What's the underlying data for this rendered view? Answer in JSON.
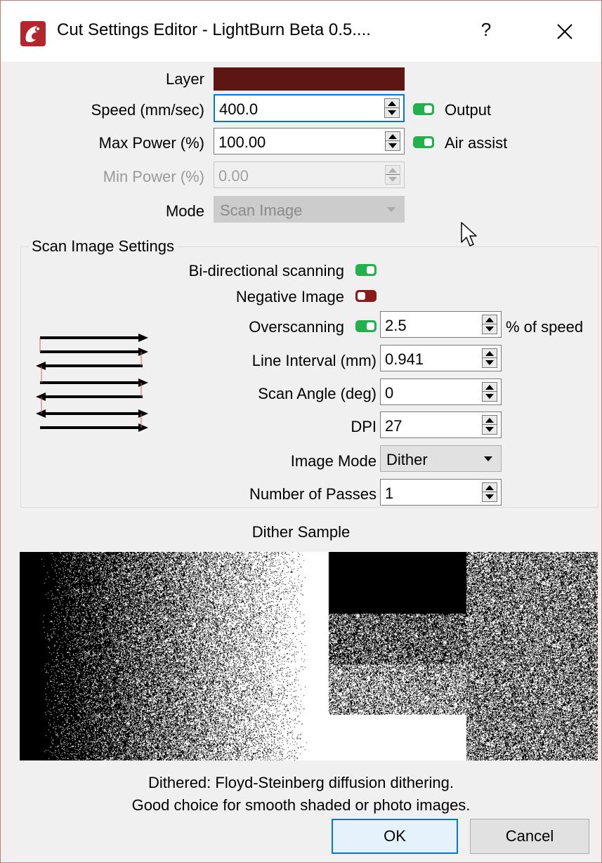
{
  "window": {
    "title": "Cut Settings Editor - LightBurn Beta 0.5....",
    "help": "?"
  },
  "colors": {
    "layer": "#5e1615",
    "toggle_on": "#22b14c",
    "toggle_off": "#8b1a1a",
    "focus": "#0078d7"
  },
  "main": {
    "layer_label": "Layer",
    "speed": {
      "label": "Speed (mm/sec)",
      "value": "400.0"
    },
    "max_power": {
      "label": "Max Power (%)",
      "value": "100.00"
    },
    "min_power": {
      "label": "Min Power (%)",
      "value": "0.00"
    },
    "mode": {
      "label": "Mode",
      "value": "Scan Image"
    },
    "output": {
      "label": "Output",
      "on": true
    },
    "air_assist": {
      "label": "Air assist",
      "on": true
    }
  },
  "scan": {
    "group_title": "Scan Image Settings",
    "bidirectional": {
      "label": "Bi-directional scanning",
      "on": true
    },
    "negative": {
      "label": "Negative Image",
      "on": false
    },
    "overscanning": {
      "label": "Overscanning",
      "on": true,
      "value": "2.5",
      "suffix": "% of speed"
    },
    "line_interval": {
      "label": "Line Interval (mm)",
      "value": "0.941"
    },
    "scan_angle": {
      "label": "Scan Angle (deg)",
      "value": "0"
    },
    "dpi": {
      "label": "DPI",
      "value": "27"
    },
    "image_mode": {
      "label": "Image Mode",
      "value": "Dither"
    },
    "passes": {
      "label": "Number of Passes",
      "value": "1"
    }
  },
  "sample": {
    "title": "Dither Sample",
    "desc1": "Dithered: Floyd-Steinberg diffusion dithering.",
    "desc2": "Good choice for smooth shaded or photo images."
  },
  "buttons": {
    "ok": "OK",
    "cancel": "Cancel"
  },
  "icons": [
    "app-logo-icon",
    "close-icon",
    "spin-arrows-icon",
    "dropdown-caret-icon",
    "scan-direction-icon",
    "mouse-pointer-icon"
  ]
}
